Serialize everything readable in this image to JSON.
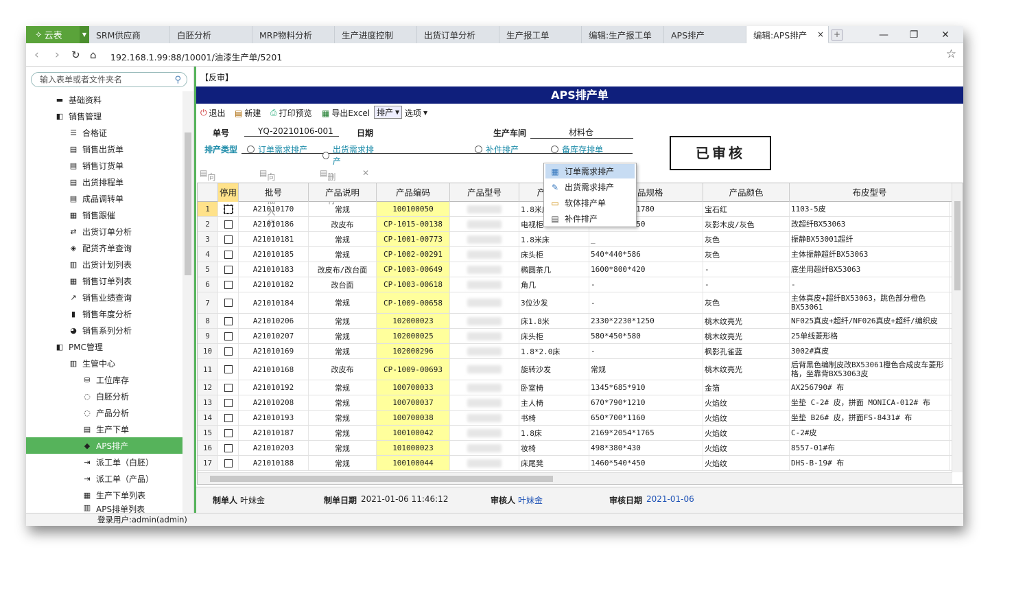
{
  "tabs": {
    "logo": "云表",
    "items": [
      "SRM供应商",
      "白胚分析",
      "MRP物料分析",
      "生产进度控制",
      "出货订单分析",
      "生产报工单",
      "编辑:生产报工单",
      "APS排产",
      "编辑:APS排产"
    ]
  },
  "address": {
    "url": "192.168.1.99:88/10001/油漆生产单/5201"
  },
  "sidebar": {
    "search_placeholder": "输入表单或者文件夹名",
    "items": [
      "基础资料",
      "销售管理",
      "合格证",
      "销售出货单",
      "销售订货单",
      "出货排程单",
      "成品调转单",
      "销售跟催",
      "出货订单分析",
      "配货齐单查询",
      "出货计划列表",
      "销售订单列表",
      "销售业绩查询",
      "销售年度分析",
      "销售系列分析",
      "PMC管理",
      "生管中心",
      "工位库存",
      "白胚分析",
      "产品分析",
      "生产下单",
      "APS排产",
      "派工单（白胚）",
      "派工单（产品）",
      "生产下单列表",
      "APS排单列表"
    ]
  },
  "status": {
    "user": "登录用户:admin(admin)"
  },
  "form": {
    "review_tag": "【反审】",
    "title": "APS排产单",
    "toolbar": {
      "exit": "退出",
      "new": "新建",
      "print": "打印预览",
      "excel": "导出Excel",
      "schedule": "排产",
      "options": "选项"
    },
    "order_no_label": "单号",
    "order_no": "YQ-20210106-001",
    "date_label": "日期",
    "workshop_label": "生产车间",
    "workshop": "材料仓",
    "type_label": "排产类型",
    "types": [
      "订单需求排产",
      "出货需求排产",
      "补件排产",
      "备库存排单"
    ],
    "stamp": "已审核",
    "row_tools": [
      "向上插入行",
      "向下插入行",
      "删除行"
    ]
  },
  "dropdown": {
    "items": [
      "订单需求排产",
      "出货需求排产",
      "软体排产单",
      "补件排产"
    ]
  },
  "grid": {
    "columns": [
      "停用",
      "批号",
      "产品说明",
      "产品编码",
      "产品型号",
      "产品名称",
      "产品规格",
      "产品颜色",
      "布皮型号"
    ],
    "rows": [
      [
        "1",
        "A21010170",
        "常规",
        "100100050",
        "1.8米床",
        "2164*2140*1780",
        "宝石红",
        "1103-5皮"
      ],
      [
        "2",
        "A21010186",
        "改皮布",
        "CP-1015-00138",
        "电视柜",
        "2000*450*550",
        "灰影木皮/灰色",
        "改超纤BX53063"
      ],
      [
        "3",
        "A21010181",
        "常规",
        "CP-1001-00773",
        "1.8米床",
        "_",
        "灰色",
        "振静BX53001超纤"
      ],
      [
        "4",
        "A21010185",
        "常规",
        "CP-1002-00291",
        "床头柜",
        "540*440*586",
        "灰色",
        "主体振静超纤BX53063"
      ],
      [
        "5",
        "A21010183",
        "改皮布/改台面",
        "CP-1003-00649",
        "椭圆茶几",
        "1600*800*420",
        "-",
        "底坐用超纤BX53063"
      ],
      [
        "6",
        "A21010182",
        "改台面",
        "CP-1003-00618",
        "角几",
        "-",
        "-",
        "-"
      ],
      [
        "7",
        "A21010184",
        "常规",
        "CP-1009-00658",
        "3位沙发",
        "-",
        "灰色",
        "主体真皮+超纤BX53063，跳色部分橙色BX53061"
      ],
      [
        "8",
        "A21010206",
        "常规",
        "102000023",
        "床1.8米",
        "2330*2230*1250",
        "桃木纹亮光",
        "NF025真皮+超纤/NF026真皮+超纤/编织皮"
      ],
      [
        "9",
        "A21010207",
        "常规",
        "102000025",
        "床头柜",
        "580*450*580",
        "桃木纹亮光",
        "25单线菱形格"
      ],
      [
        "10",
        "A21010169",
        "常规",
        "102000296",
        "1.8*2.0床",
        "-",
        "枫影孔雀蓝",
        "3002#真皮"
      ],
      [
        "11",
        "A21010168",
        "改皮布",
        "CP-1009-00693",
        "旋转沙发",
        "常规",
        "桃木纹亮光",
        "后背黑色编制皮改BX53061橙色合成皮车菱形格，坐靠背BX53063皮"
      ],
      [
        "12",
        "A21010192",
        "常规",
        "100700033",
        "卧室椅",
        "1345*685*910",
        "金箔",
        "AX256790# 布"
      ],
      [
        "13",
        "A21010208",
        "常规",
        "100700037",
        "主人椅",
        "670*790*1210",
        "火焰纹",
        "坐垫 C-2# 皮，拼面 MONICA-012# 布"
      ],
      [
        "14",
        "A21010193",
        "常规",
        "100700038",
        "书椅",
        "650*700*1160",
        "火焰纹",
        "坐垫 B26# 皮，拼面FS-8431# 布"
      ],
      [
        "15",
        "A21010187",
        "常规",
        "100100042",
        "1.8床",
        "2169*2054*1765",
        "火焰纹",
        "C-2#皮"
      ],
      [
        "16",
        "A21010203",
        "常规",
        "101000023",
        "妆椅",
        "498*380*430",
        "火焰纹",
        "8557-01#布"
      ],
      [
        "17",
        "A21010188",
        "常规",
        "100100044",
        "床尾凳",
        "1460*540*450",
        "火焰纹",
        "DHS-B-19# 布"
      ]
    ]
  },
  "footer": {
    "maker_label": "制单人",
    "maker": "叶妹金",
    "make_date_label": "制单日期",
    "make_date": "2021-01-06 11:46:12",
    "auditor_label": "审核人",
    "auditor": "叶妹金",
    "audit_date_label": "审核日期",
    "audit_date": "2021-01-06"
  }
}
